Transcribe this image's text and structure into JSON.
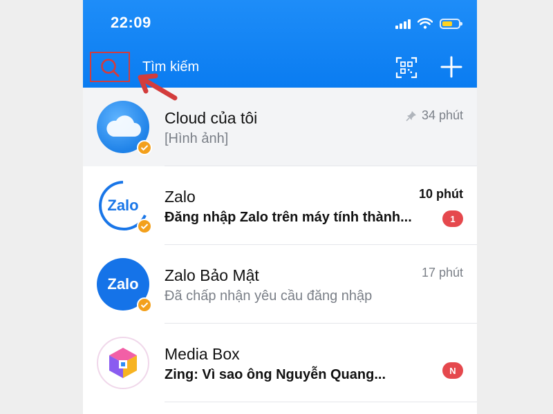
{
  "status_bar": {
    "time": "22:09"
  },
  "header": {
    "search_placeholder": "Tìm kiếm"
  },
  "conversations": [
    {
      "name": "Cloud của tôi",
      "preview": "[Hình ảnh]",
      "time": "34 phút",
      "pinned": true,
      "unread": false,
      "badge": ""
    },
    {
      "name": "Zalo",
      "preview": "Đăng nhập Zalo trên máy tính thành...",
      "time": "10 phút",
      "pinned": false,
      "unread": true,
      "badge": "1"
    },
    {
      "name": "Zalo Bảo Mật",
      "preview": "Đã chấp nhận yêu cầu đăng nhập",
      "time": "17 phút",
      "pinned": false,
      "unread": false,
      "badge": ""
    },
    {
      "name": "Media Box",
      "preview": "Zing: Vì sao ông Nguyễn Quang...",
      "time": "",
      "pinned": false,
      "unread": true,
      "badge": "N"
    }
  ],
  "avatar_text": {
    "zalo": "Zalo",
    "zalo_security": "Zalo"
  },
  "colors": {
    "header_blue": "#0a7cf1",
    "badge_red": "#e5484d",
    "verified_orange": "#f3a01c",
    "annotation_red": "#d33c3c"
  },
  "icons": [
    "search-icon",
    "qr-scan-icon",
    "plus-icon",
    "pin-icon",
    "verified-icon",
    "wifi-icon",
    "signal-icon",
    "battery-icon",
    "annotation-arrow"
  ]
}
